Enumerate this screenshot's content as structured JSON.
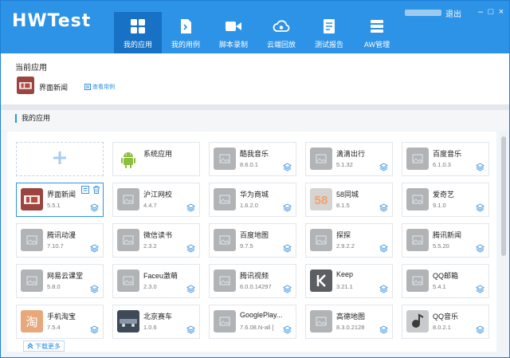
{
  "header": {
    "logo": "HWTest",
    "logout": "退出",
    "controls": {
      "minimize": "–",
      "maximize": "□",
      "close": "×"
    },
    "nav": [
      {
        "id": "apps",
        "label": "我的应用",
        "icon": "apps-grid-icon",
        "active": true
      },
      {
        "id": "cases",
        "label": "我的用例",
        "icon": "script-file-icon",
        "active": false
      },
      {
        "id": "record",
        "label": "脚本录制",
        "icon": "video-camera-icon",
        "active": false
      },
      {
        "id": "cloud",
        "label": "云端回放",
        "icon": "cloud-replay-icon",
        "active": false
      },
      {
        "id": "report",
        "label": "测试报告",
        "icon": "report-document-icon",
        "active": false
      },
      {
        "id": "aw",
        "label": "AW管理",
        "icon": "stack-management-icon",
        "active": false
      }
    ]
  },
  "current": {
    "title": "当前应用",
    "app_name": "界面新闻",
    "view_cases": "查看用例"
  },
  "my_apps": {
    "title": "我的应用",
    "more": "下载更多",
    "apps": [
      {
        "name": "系统应用",
        "version": "",
        "icon": "android"
      },
      {
        "name": "酷我音乐",
        "version": "8.6.0.1",
        "icon": "placeholder"
      },
      {
        "name": "滴滴出行",
        "version": "5.1.32",
        "icon": "placeholder"
      },
      {
        "name": "百度音乐",
        "version": "6.1.0.3",
        "icon": "placeholder"
      },
      {
        "name": "界面新闻",
        "version": "5.5.1",
        "icon": "jiemian",
        "selected": true
      },
      {
        "name": "沪江网校",
        "version": "4.4.7",
        "icon": "placeholder"
      },
      {
        "name": "华为商城",
        "version": "1.6.2.0",
        "icon": "placeholder"
      },
      {
        "name": "58同城",
        "version": "8.1.5",
        "icon": "58"
      },
      {
        "name": "爱奇艺",
        "version": "9.1.0",
        "icon": "placeholder"
      },
      {
        "name": "腾讯动漫",
        "version": "7.10.7",
        "icon": "placeholder"
      },
      {
        "name": "微信读书",
        "version": "2.3.2",
        "icon": "placeholder"
      },
      {
        "name": "百度地图",
        "version": "9.7.5",
        "icon": "placeholder"
      },
      {
        "name": "探探",
        "version": "2.9.2.2",
        "icon": "placeholder"
      },
      {
        "name": "腾讯新闻",
        "version": "5.5.20",
        "icon": "placeholder"
      },
      {
        "name": "网易云课堂",
        "version": "5.8.0",
        "icon": "placeholder"
      },
      {
        "name": "Faceu激萌",
        "version": "2.3.0",
        "icon": "placeholder"
      },
      {
        "name": "腾讯视频",
        "version": "6.0.0.14297",
        "icon": "placeholder"
      },
      {
        "name": "Keep",
        "version": "3.21.1",
        "icon": "keep"
      },
      {
        "name": "QQ邮箱",
        "version": "5.4.1",
        "icon": "placeholder"
      },
      {
        "name": "手机淘宝",
        "version": "7.5.4",
        "icon": "taobao"
      },
      {
        "name": "北京赛车",
        "version": "1.0.6",
        "icon": "racing"
      },
      {
        "name": "GooglePlay...",
        "version": "7.6.08.N-all [",
        "icon": "placeholder"
      },
      {
        "name": "高德地图",
        "version": "8.3.0.2128",
        "icon": "placeholder"
      },
      {
        "name": "QQ音乐",
        "version": "8.0.2.1",
        "icon": "qqmusic"
      }
    ]
  }
}
